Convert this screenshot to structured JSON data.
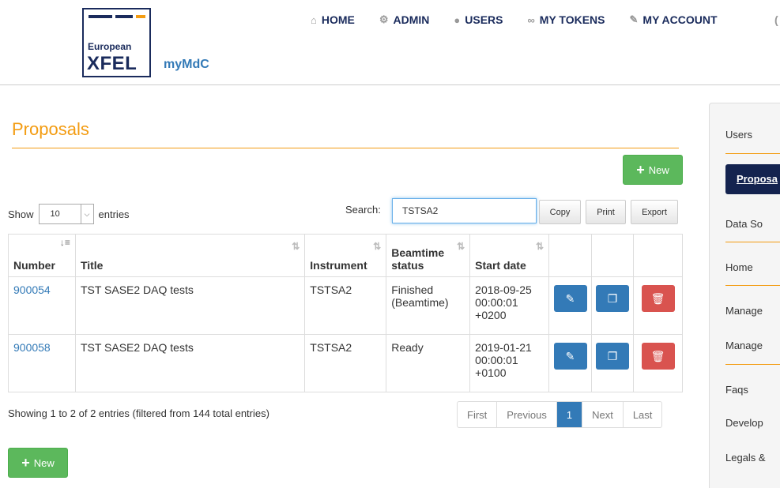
{
  "header": {
    "logo_line1": "European",
    "logo_line2": "XFEL",
    "app_name": "myMdC",
    "nav": [
      {
        "label": "HOME",
        "icon": "home-icon"
      },
      {
        "label": "ADMIN",
        "icon": "gear-icon"
      },
      {
        "label": "USERS",
        "icon": "user-icon"
      },
      {
        "label": "MY TOKENS",
        "icon": "link-icon"
      },
      {
        "label": "MY ACCOUNT",
        "icon": "edit-icon"
      }
    ],
    "colors": {
      "brand_navy": "#1a2b5c",
      "accent_orange": "#f39c12"
    }
  },
  "main": {
    "title": "Proposals",
    "new_label": "New",
    "show_label": "Show",
    "entries_label": "entries",
    "page_size": "10",
    "search_label": "Search:",
    "search_value": "TSTSA2",
    "copy_label": "Copy",
    "print_label": "Print",
    "export_label": "Export",
    "columns": [
      "Number",
      "Title",
      "Instrument",
      "Beamtime status",
      "Start date"
    ],
    "rows": [
      {
        "number": "900054",
        "title": "TST SASE2 DAQ tests",
        "instrument": "TSTSA2",
        "status": "Finished (Beamtime)",
        "start_date": [
          "2018-09-25",
          "00:00:01",
          "+0200"
        ]
      },
      {
        "number": "900058",
        "title": "TST SASE2 DAQ tests",
        "instrument": "TSTSA2",
        "status": "Ready",
        "start_date": [
          "2019-01-21",
          "00:00:01",
          "+0100"
        ]
      }
    ],
    "info": "Showing 1 to 2 of 2 entries (filtered from 144 total entries)",
    "pagination": {
      "first": "First",
      "previous": "Previous",
      "current": "1",
      "next": "Next",
      "last": "Last"
    }
  },
  "sidebar": {
    "items": [
      "Users",
      "Proposa",
      "Data So",
      "Home",
      "Manage",
      "Manage",
      "Faqs",
      "Develop",
      "Legals &"
    ],
    "active_index": 1
  }
}
